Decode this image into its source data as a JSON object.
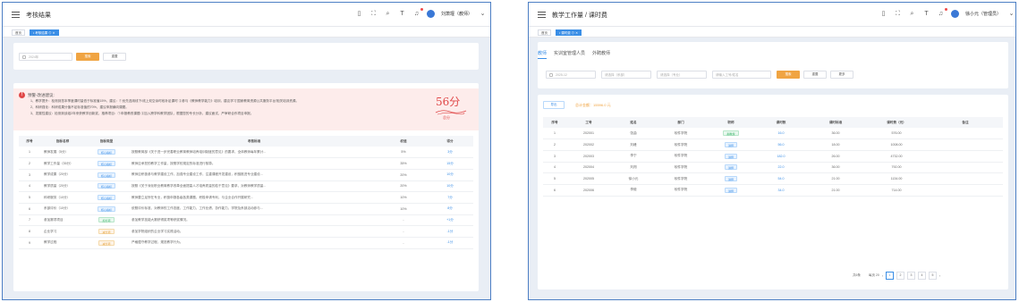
{
  "left": {
    "title": "考核结果",
    "user": "刘萧堰（教师）",
    "tags": [
      "首页",
      "• 考核结果 ⊙ ✕"
    ],
    "filter": {
      "year_value": "2024年",
      "search": "搜索",
      "reset": "重置"
    },
    "alert": {
      "title": "预警-改进建议:",
      "lines": [
        "1、教学提升：检测到您本季度课时量低于标准值15%，建议：①优先选用线下/线上双空余时段补足课时 ②参与《教师教学能力》培训，建议学习'国家教育资源公共服务平台'相关培训资源。",
        "2、科研强化：科研成果分值不足标准值的70%，建议申报横向课题。",
        "3、发展性建议：检测到该组2年来获教学创新奖，推荐项目：①申报教改课题 ②加入跨学科教学团队，根据您的专长分析，建议面试、严审研合作项目申报。"
      ],
      "score": "56分",
      "score_label": "总分"
    },
    "columns": [
      "序号",
      "指标名称",
      "指标类型",
      "考核标准",
      "权值",
      "得分"
    ],
    "rows": [
      [
        "1",
        "教师发展（5分）",
        "核心指标",
        "按照教育部《关于进一步完善职业教育教师培养培训制度的意见》的要求，全体教师每年累计...",
        "5%",
        "3分"
      ],
      [
        "2",
        "教学工作量（35分）",
        "核心指标",
        "教师应承担的教学工作量，按照学校规定的标准进行核算。",
        "35%",
        "15分"
      ],
      [
        "3",
        "教学成果（20分）",
        "核心指标",
        "教师应积极参与教学建设工作，加强专业建设工作，注重课程开发建设，积极推进专业建设...",
        "20%",
        "10分"
      ],
      [
        "4",
        "教学质量（20分）",
        "核心指标",
        "按照《关于深化职业教育教学改革全面提高人才培养质量的若干意见》要求，对教师教学质量...",
        "20%",
        "10分"
      ],
      [
        "5",
        "科研服务（10分）",
        "核心指标",
        "教师要立足所在专业，积极申报各级各类课题，积极申请专利，与企业合作开展研究...",
        "10%",
        "7分"
      ],
      [
        "6",
        "系部评价（10分）",
        "核心指标",
        "依照评价标准，对教师的工作态度、工作能力、工作业绩、协作能力、学院及系部活动参与...",
        "10%",
        "8分"
      ],
      [
        "7",
        "参加赛项项目",
        "加分项",
        "参加教学技能大赛获得奖项等获奖情况。",
        "-",
        "+1分"
      ],
      [
        "8",
        "企业学习",
        "减分项",
        "参加学院组织的企业学习实践活动。",
        "-",
        "-1分"
      ],
      [
        "9",
        "教学过程",
        "减分项",
        "严格遵守教学过程，规范教学行为。",
        "-",
        "-1分"
      ]
    ]
  },
  "right": {
    "title": "教学工作量 / 课时费",
    "user": "徐小元（管理员）",
    "tags": [
      "首页",
      "• 课时费 ⊙ ✕"
    ],
    "tabs": [
      "教师",
      "实训室管理人员",
      "外聘教师"
    ],
    "filter": {
      "date_value": "2025-12",
      "college_placeholder": "请选择（系部）",
      "major_placeholder": "请选择（专业）",
      "name_placeholder": "请输入工号/姓名",
      "search": "搜索",
      "reset": "重置",
      "more": "更多"
    },
    "export": "导出",
    "total": "总计金额：15596.0 元",
    "columns": [
      "序号",
      "工号",
      "姓名",
      "部门",
      "职称",
      "课时数",
      "课时标准",
      "课时费（元）",
      "备注"
    ],
    "rows": [
      [
        "1",
        "202001",
        "张曲",
        "软件学院",
        "副教授",
        "16.0",
        "36.00",
        "576.00",
        ""
      ],
      [
        "2",
        "202002",
        "刘峰",
        "软件学院",
        "讲师",
        "56.0",
        "18.00",
        "1008.00",
        ""
      ],
      [
        "3",
        "202003",
        "李宁",
        "软件学院",
        "讲师",
        "182.0",
        "26.00",
        "4732.00",
        ""
      ],
      [
        "4",
        "202004",
        "刘闯",
        "软件学院",
        "讲师",
        "22.0",
        "36.00",
        "792.00",
        ""
      ],
      [
        "5",
        "202005",
        "徐小元",
        "软件学院",
        "讲师",
        "54.0",
        "21.00",
        "1134.00",
        ""
      ],
      [
        "6",
        "202006",
        "李毅",
        "软件学院",
        "讲师",
        "34.0",
        "21.00",
        "714.00",
        ""
      ]
    ],
    "pager": {
      "total": "共6条",
      "size": "每页 20",
      "pages": [
        "1",
        "2",
        "3",
        "4",
        "5"
      ]
    }
  }
}
